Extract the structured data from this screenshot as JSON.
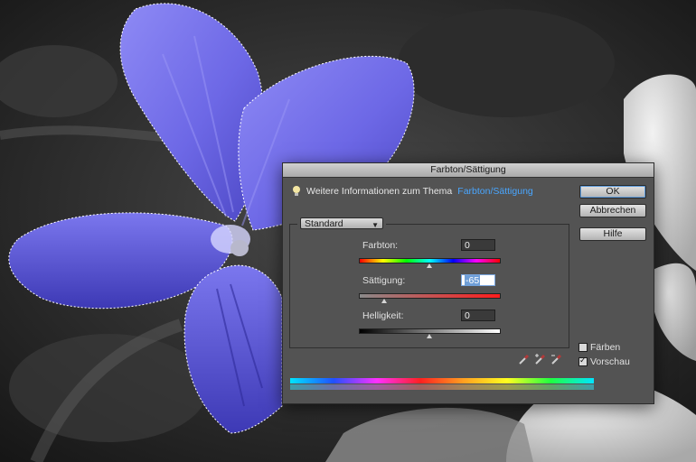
{
  "dialog": {
    "title": "Farbton/Sättigung",
    "info_text": "Weitere Informationen zum Thema",
    "info_link": "Farbton/Sättigung",
    "preset": "Standard",
    "buttons": {
      "ok": "OK",
      "cancel": "Abbrechen",
      "help": "Hilfe"
    },
    "hue": {
      "label": "Farbton:",
      "value": "0",
      "slider_fraction": 0.5
    },
    "saturation": {
      "label": "Sättigung:",
      "value": "-65",
      "slider_fraction": 0.18
    },
    "lightness": {
      "label": "Helligkeit:",
      "value": "0",
      "slider_fraction": 0.5
    },
    "colorize": {
      "label": "Färben",
      "checked": false
    },
    "preview": {
      "label": "Vorschau",
      "checked": true
    }
  },
  "colors": {
    "dialog_bg": "#535353",
    "link": "#49a6ff",
    "flower": "#6b67e0"
  },
  "icons": [
    "lightbulb-icon",
    "eyedropper-icon",
    "eyedropper-plus-icon",
    "eyedropper-minus-icon"
  ]
}
